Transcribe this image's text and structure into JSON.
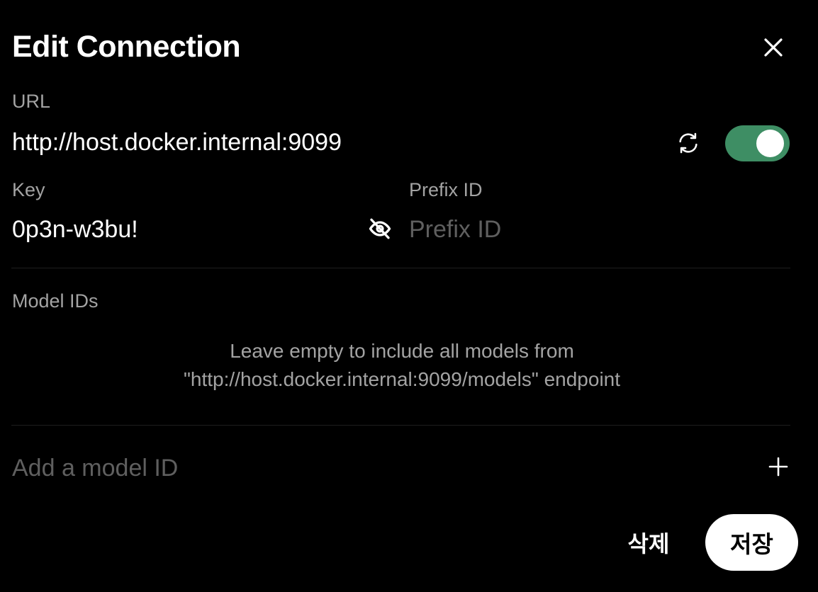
{
  "dialog": {
    "title": "Edit Connection"
  },
  "url_section": {
    "label": "URL",
    "value": "http://host.docker.internal:9099",
    "enabled": true
  },
  "key_section": {
    "label": "Key",
    "value": "0p3n-w3bu!"
  },
  "prefix_section": {
    "label": "Prefix ID",
    "placeholder": "Prefix ID",
    "value": ""
  },
  "models_section": {
    "label": "Model IDs",
    "hint_line1": "Leave empty to include all models from",
    "hint_line2": "\"http://host.docker.internal:9099/models\" endpoint",
    "add_placeholder": "Add a model ID"
  },
  "footer": {
    "delete_label": "삭제",
    "save_label": "저장"
  },
  "icons": {
    "close": "close-icon",
    "refresh": "refresh-icon",
    "eye": "eye-off-icon",
    "add": "plus-icon"
  },
  "colors": {
    "background": "#000000",
    "toggle_on": "#3e8e64",
    "label": "#a3a3a3",
    "placeholder": "#5f5f5f"
  }
}
